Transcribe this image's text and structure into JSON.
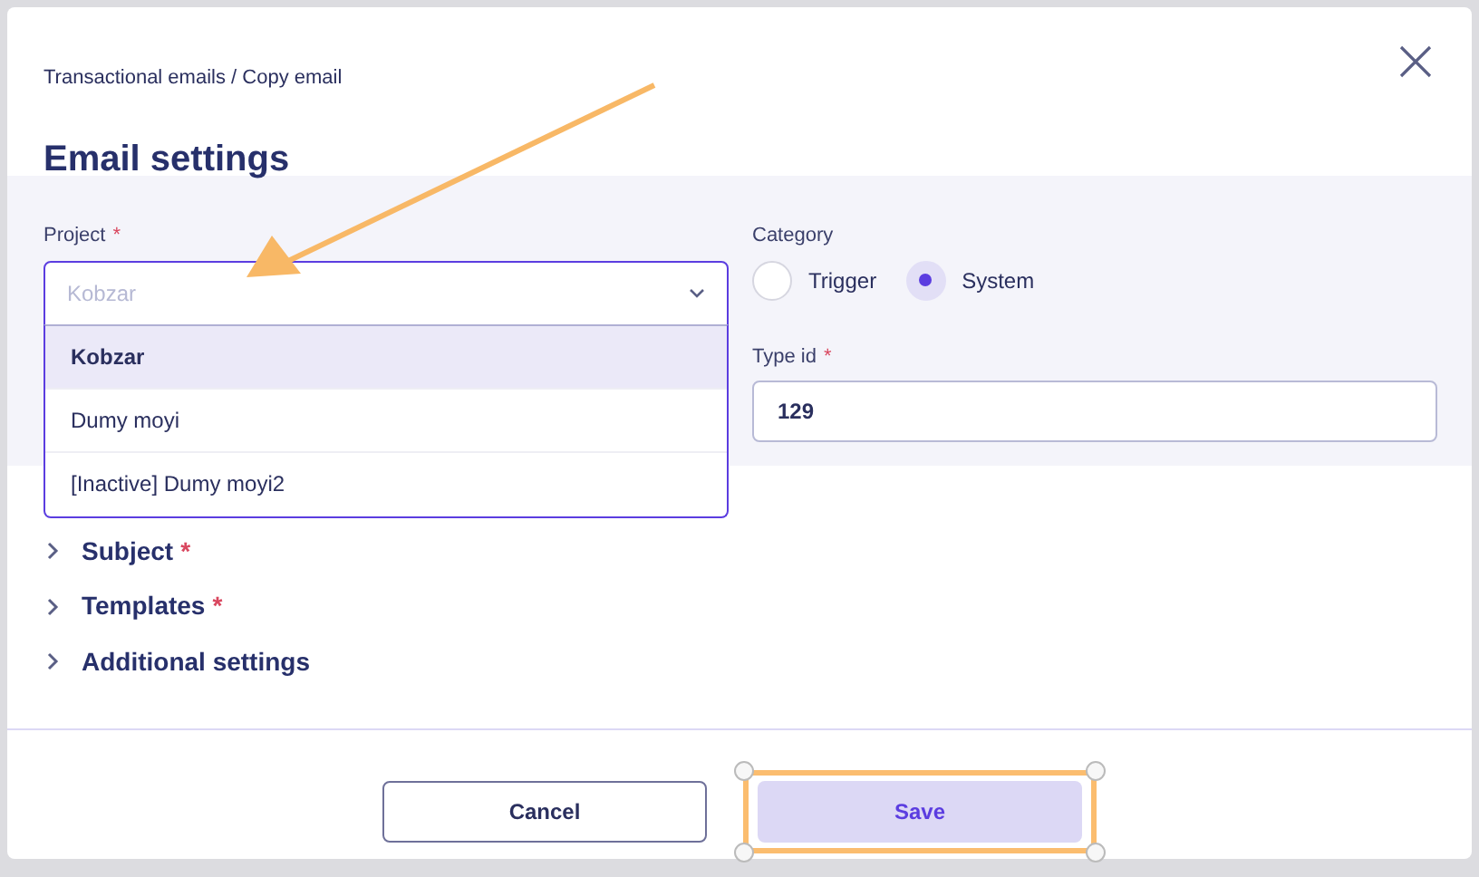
{
  "breadcrumb": "Transactional emails / Copy email",
  "title": "Email settings",
  "project": {
    "label": "Project",
    "required_mark": "*",
    "placeholder": "Kobzar",
    "expanded": true,
    "options": [
      {
        "label": "Kobzar",
        "selected": true
      },
      {
        "label": "Dumy moyi",
        "selected": false
      },
      {
        "label": "[Inactive] Dumy moyi2",
        "selected": false
      }
    ]
  },
  "category": {
    "label": "Category",
    "options": [
      {
        "label": "Trigger",
        "selected": false
      },
      {
        "label": "System",
        "selected": true
      }
    ]
  },
  "type_id": {
    "label": "Type id",
    "required_mark": "*",
    "value": "129"
  },
  "sections": [
    {
      "label": "Subject",
      "required_mark": "*",
      "expanded": false
    },
    {
      "label": "Templates",
      "required_mark": "*",
      "expanded": false
    },
    {
      "label": "Additional settings",
      "expanded": false
    }
  ],
  "buttons": [
    {
      "label": "Cancel",
      "kind": "secondary"
    },
    {
      "label": "Save",
      "kind": "primary",
      "highlighted": true
    }
  ]
}
